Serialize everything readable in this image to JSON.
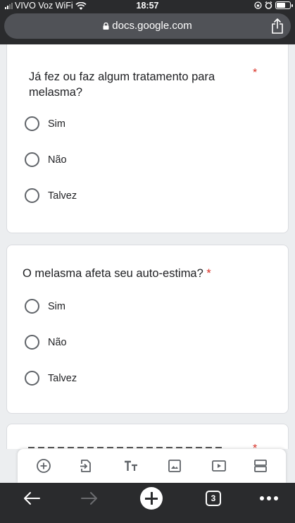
{
  "status_bar": {
    "carrier": "VIVO Voz WiFi",
    "time": "18:57"
  },
  "browser": {
    "url": "docs.google.com",
    "tab_count": "3"
  },
  "questions": [
    {
      "title_line1": "Já fez ou faz algum tratamento para",
      "title_line2": "melasma?",
      "required": "*",
      "options": [
        "Sim",
        "Não",
        "Talvez"
      ]
    },
    {
      "title_line1": "O melasma afeta seu auto-estima?",
      "required": "*",
      "options": [
        "Sim",
        "Não",
        "Talvez"
      ]
    },
    {
      "title_line1": "",
      "required": "*",
      "options": []
    }
  ],
  "toolbar": {
    "icons": [
      "add-question-icon",
      "import-questions-icon",
      "add-title-icon",
      "add-image-icon",
      "add-video-icon",
      "add-section-icon"
    ]
  },
  "colors": {
    "accent_required": "#d93025",
    "chrome": "#2a2b2d",
    "page_bg": "#eceef0"
  }
}
